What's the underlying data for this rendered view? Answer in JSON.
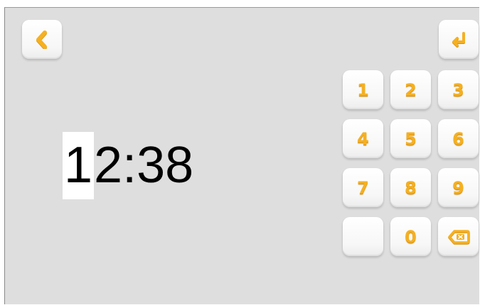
{
  "time": {
    "value": "12:38",
    "cursor_char": "1",
    "rest": "2:38"
  },
  "keypad": {
    "keys": [
      "1",
      "2",
      "3",
      "4",
      "5",
      "6",
      "7",
      "8",
      "9",
      "",
      "0"
    ]
  },
  "icons": {
    "back": "chevron-left-icon",
    "enter": "enter-return-icon",
    "backspace": "backspace-icon"
  },
  "colors": {
    "background": "#dedede",
    "accent": "#f5b021",
    "tile": "#ffffff",
    "text": "#000000"
  }
}
